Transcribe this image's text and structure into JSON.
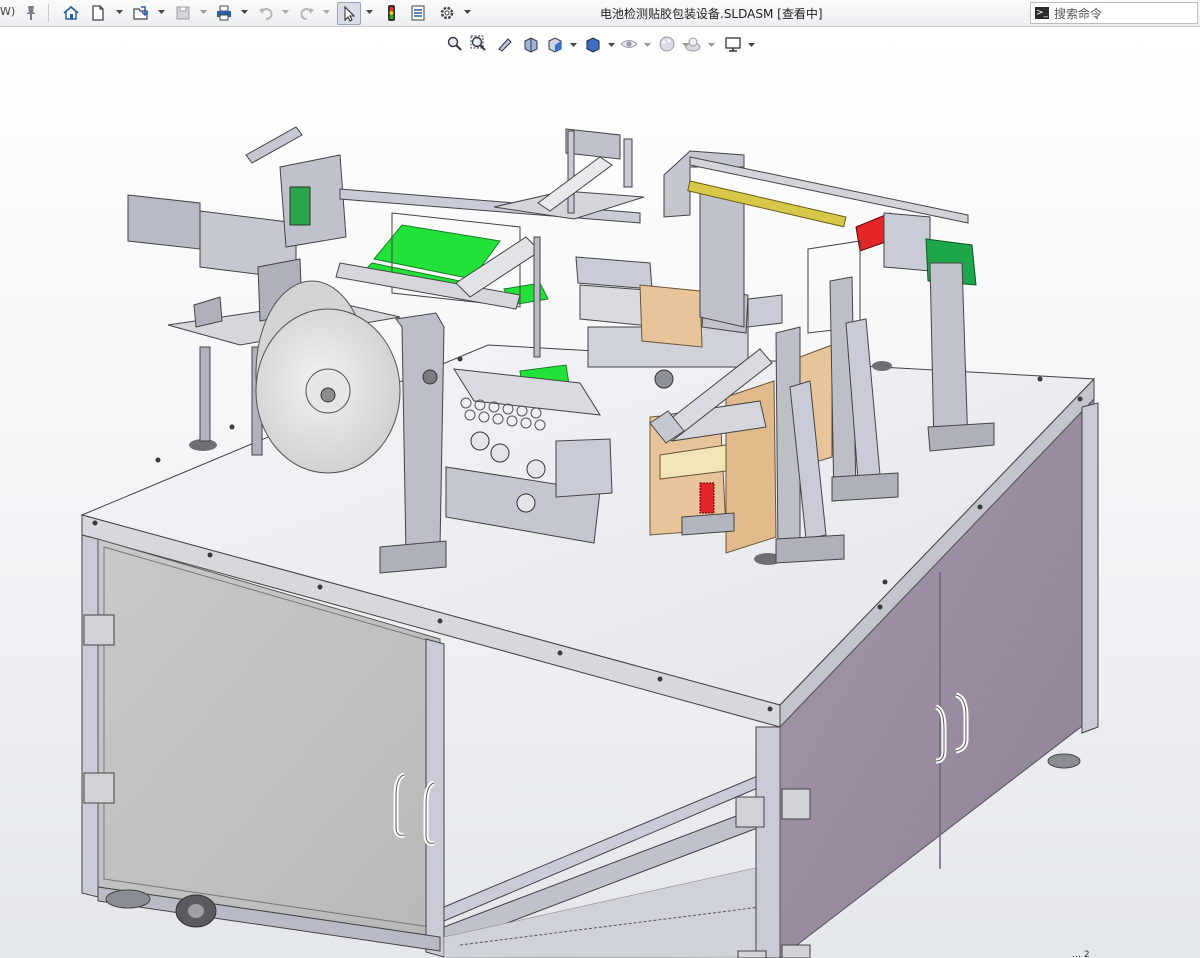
{
  "titlebar": {
    "left_stub": "W)",
    "document_title": "电池检测贴胶包装设备.SLDASM [查看中]",
    "search_placeholder": "搜索命令"
  },
  "toolbar": {
    "buttons": [
      {
        "name": "pin-icon"
      },
      {
        "name": "home-icon"
      },
      {
        "name": "new-document-icon"
      },
      {
        "name": "open-icon"
      },
      {
        "name": "save-icon"
      },
      {
        "name": "print-icon"
      },
      {
        "name": "undo-icon"
      },
      {
        "name": "redo-icon"
      },
      {
        "name": "select-pointer-icon"
      },
      {
        "name": "traffic-light-icon"
      },
      {
        "name": "file-properties-icon"
      },
      {
        "name": "options-gear-icon"
      }
    ]
  },
  "heads_up_toolbar": {
    "buttons": [
      {
        "name": "zoom-to-fit-icon"
      },
      {
        "name": "zoom-area-icon"
      },
      {
        "name": "previous-view-icon"
      },
      {
        "name": "section-view-icon"
      },
      {
        "name": "view-orientation-icon"
      },
      {
        "name": "display-style-icon"
      },
      {
        "name": "hide-show-items-icon"
      },
      {
        "name": "edit-appearance-icon"
      },
      {
        "name": "apply-scene-icon"
      },
      {
        "name": "view-settings-icon"
      }
    ]
  },
  "model": {
    "description_colors": {
      "frame": "#c9ccd6",
      "panel_left": "#c4c4c4",
      "panel_right": "#9c8fa3",
      "green_parts": "#22e23a",
      "wood_parts": "#e7c49a",
      "motor": "#1ea64a",
      "red_part": "#e3262a",
      "screw": "#d7c84a"
    }
  },
  "status": {
    "corner_glyph": "… 2"
  }
}
